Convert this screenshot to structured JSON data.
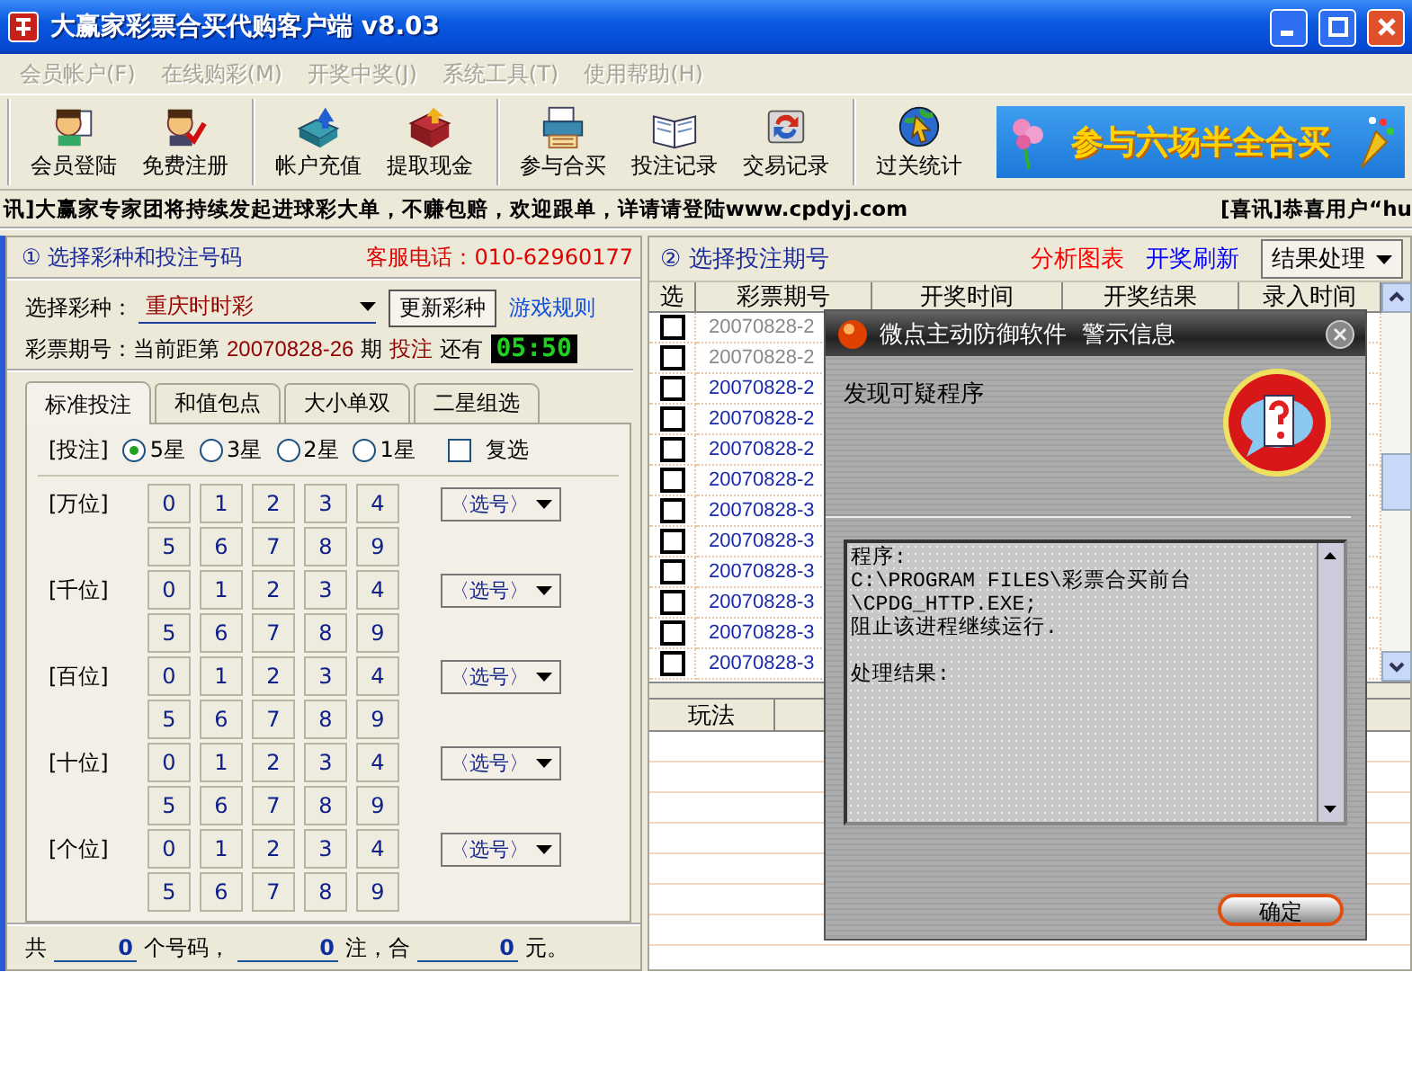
{
  "window": {
    "title": "大赢家彩票合买代购客户端 v8.03"
  },
  "menu": [
    {
      "label": "会员帐户(F)",
      "disabled": true
    },
    {
      "label": "在线购彩(M)",
      "disabled": true
    },
    {
      "label": "开奖中奖(J)",
      "disabled": true
    },
    {
      "label": "系统工具(T)",
      "disabled": true
    },
    {
      "label": "使用帮助(H)",
      "disabled": true
    }
  ],
  "toolbar": [
    [
      {
        "label": "会员登陆"
      },
      {
        "label": "免费注册"
      }
    ],
    [
      {
        "label": "帐户充值"
      },
      {
        "label": "提取现金"
      }
    ],
    [
      {
        "label": "参与合买"
      },
      {
        "label": "投注记录"
      },
      {
        "label": "交易记录"
      }
    ],
    [
      {
        "label": "过关统计"
      }
    ]
  ],
  "banner": {
    "text": "参与六场半全合买"
  },
  "ticker": {
    "left": "讯]大赢家专家团将持续发起进球彩大单，不赚包赔，欢迎跟单，详请请登陆www.cpdyj.com",
    "right": "[喜讯]恭喜用户“hu"
  },
  "bet_panel": {
    "title": "① 选择彩种和投注号码",
    "hotline": "客服电话：010-62960177",
    "lottery_label": "选择彩种：",
    "lottery_value": "重庆时时彩",
    "refresh_button": "更新彩种",
    "rules_link": "游戏规则",
    "issue": {
      "label": "彩票期号：当前距第",
      "number": "20070828-26",
      "unit": "期",
      "action": "投注",
      "remaining": "还有",
      "countdown": "05:50"
    },
    "tabs": [
      {
        "label": "标准投注",
        "selected": true
      },
      {
        "label": "和值包点",
        "selected": false
      },
      {
        "label": "大小单双",
        "selected": false
      },
      {
        "label": "二星组选",
        "selected": false
      }
    ],
    "bet_label": "[投注]",
    "stars": [
      {
        "label": "5星",
        "selected": true
      },
      {
        "label": "3星",
        "selected": false
      },
      {
        "label": "2星",
        "selected": false
      },
      {
        "label": "1星",
        "selected": false
      }
    ],
    "multi": {
      "label": "复选",
      "checked": false
    },
    "positions": [
      {
        "label": "[万位]",
        "digits": [
          "0",
          "1",
          "2",
          "3",
          "4",
          "5",
          "6",
          "7",
          "8",
          "9"
        ],
        "picker": "〈选号〉"
      },
      {
        "label": "[千位]",
        "digits": [
          "0",
          "1",
          "2",
          "3",
          "4",
          "5",
          "6",
          "7",
          "8",
          "9"
        ],
        "picker": "〈选号〉"
      },
      {
        "label": "[百位]",
        "digits": [
          "0",
          "1",
          "2",
          "3",
          "4",
          "5",
          "6",
          "7",
          "8",
          "9"
        ],
        "picker": "〈选号〉"
      },
      {
        "label": "[十位]",
        "digits": [
          "0",
          "1",
          "2",
          "3",
          "4",
          "5",
          "6",
          "7",
          "8",
          "9"
        ],
        "picker": "〈选号〉"
      },
      {
        "label": "[个位]",
        "digits": [
          "0",
          "1",
          "2",
          "3",
          "4",
          "5",
          "6",
          "7",
          "8",
          "9"
        ],
        "picker": "〈选号〉"
      }
    ],
    "totals": {
      "prefix": "共",
      "count": "0",
      "count_unit": "个号码，",
      "bets": "0",
      "bets_unit": "注，合",
      "amount": "0",
      "amount_unit": "元。"
    }
  },
  "issue_panel": {
    "title": "② 选择投注期号",
    "links": [
      {
        "label": "分析图表",
        "color": "#ff0000"
      },
      {
        "label": "开奖刷新",
        "color": "#0000ff"
      }
    ],
    "result_button": "结果处理",
    "columns": [
      "选",
      "彩票期号",
      "开奖时间",
      "开奖结果",
      "录入时间"
    ],
    "rows": [
      {
        "checked": false,
        "disabled": true,
        "issue": "20070828-2"
      },
      {
        "checked": false,
        "disabled": true,
        "issue": "20070828-2"
      },
      {
        "checked": false,
        "disabled": false,
        "issue": "20070828-2"
      },
      {
        "checked": false,
        "disabled": false,
        "issue": "20070828-2"
      },
      {
        "checked": false,
        "disabled": false,
        "issue": "20070828-2"
      },
      {
        "checked": false,
        "disabled": false,
        "issue": "20070828-2"
      },
      {
        "checked": false,
        "disabled": false,
        "issue": "20070828-3"
      },
      {
        "checked": false,
        "disabled": false,
        "issue": "20070828-3"
      },
      {
        "checked": false,
        "disabled": false,
        "issue": "20070828-3"
      },
      {
        "checked": false,
        "disabled": false,
        "issue": "20070828-3"
      },
      {
        "checked": false,
        "disabled": false,
        "issue": "20070828-3"
      },
      {
        "checked": false,
        "disabled": false,
        "issue": "20070828-3"
      }
    ],
    "lower_columns": [
      "玩法"
    ]
  },
  "dialog": {
    "title": "微点主动防御软件  警示信息",
    "heading": "发现可疑程序",
    "lines": [
      "程序:",
      "C:\\PROGRAM FILES\\彩票合买前台",
      "\\CPDG_HTTP.EXE;",
      "阻止该进程继续运行."
    ],
    "result_label": "处理结果:",
    "ok_button": "确定"
  }
}
